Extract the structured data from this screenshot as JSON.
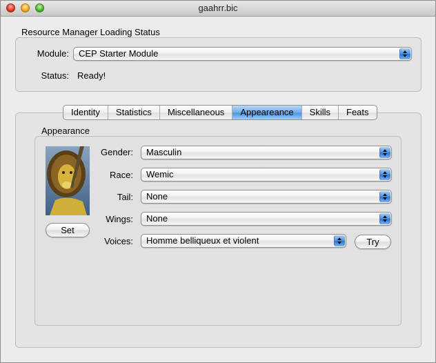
{
  "window": {
    "title": "gaahrr.bic"
  },
  "status_section": {
    "heading": "Resource Manager Loading Status",
    "module_label": "Module:",
    "module_value": "CEP Starter Module",
    "status_label": "Status:",
    "status_value": "Ready!"
  },
  "tabs": [
    {
      "label": "Identity",
      "active": false
    },
    {
      "label": "Statistics",
      "active": false
    },
    {
      "label": "Miscellaneous",
      "active": false
    },
    {
      "label": "Appeareance",
      "active": true
    },
    {
      "label": "Skills",
      "active": false
    },
    {
      "label": "Feats",
      "active": false
    }
  ],
  "appearance": {
    "heading": "Appearance",
    "set_button": "Set",
    "try_button": "Try",
    "fields": {
      "gender": {
        "label": "Gender:",
        "value": "Masculin"
      },
      "race": {
        "label": "Race:",
        "value": "Wemic"
      },
      "tail": {
        "label": "Tail:",
        "value": "None"
      },
      "wings": {
        "label": "Wings:",
        "value": "None"
      },
      "voices": {
        "label": "Voices:",
        "value": "Homme belliqueux et violent"
      }
    }
  },
  "colors": {
    "accent": "#4f95e3",
    "window_bg": "#ececec"
  },
  "icons": {
    "portrait": "lion-warrior-portrait"
  }
}
